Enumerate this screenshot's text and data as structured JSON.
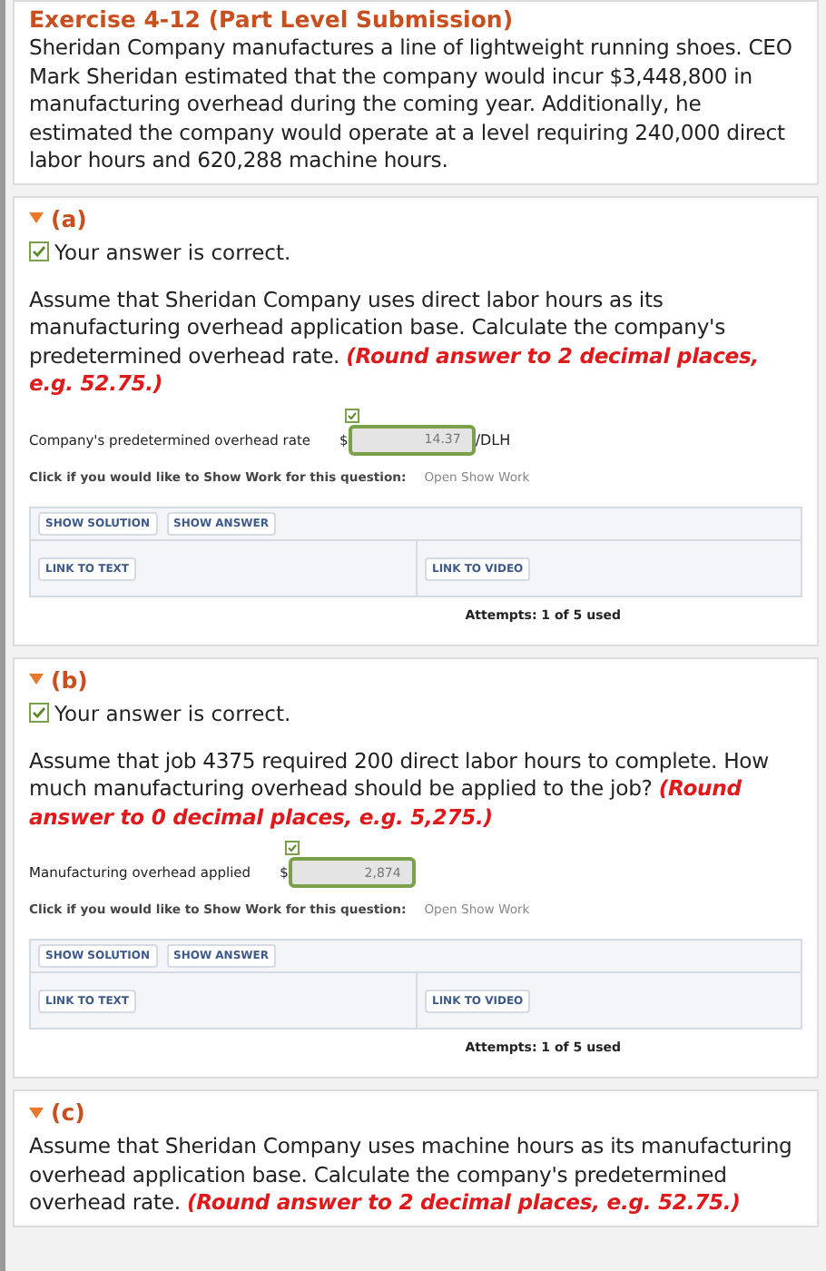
{
  "exercise": {
    "title": "Exercise 4-12 (Part Level Submission)",
    "text": "Sheridan Company manufactures a line of lightweight running shoes. CEO Mark Sheridan estimated that the company would incur $3,448,800 in manufacturing overhead during the coming year. Additionally, he estimated the company would operate at a level requiring 240,000 direct labor hours and 620,288 machine hours."
  },
  "parts": [
    {
      "label": "(a)",
      "expanded": true,
      "feedback": {
        "correct": true,
        "text": "Your answer is correct."
      },
      "question": "Assume that Sheridan Company uses direct labor hours as its manufacturing overhead application base. Calculate the company's predetermined overhead rate.",
      "instruction": "(Round answer to 2 decimal places, e.g. 52.75.)",
      "answer": {
        "label": "Company's predetermined overhead rate",
        "currency": "$",
        "value": "14.37",
        "unit": "/DLH",
        "correct": true
      },
      "show_work": {
        "prompt": "Click if you would like to Show Work for this question:",
        "link": "Open Show Work"
      },
      "buttons": [
        "SHOW SOLUTION",
        "SHOW ANSWER"
      ],
      "links": [
        "LINK TO TEXT",
        "LINK TO VIDEO"
      ],
      "attempts": "Attempts: 1 of 5 used"
    },
    {
      "label": "(b)",
      "expanded": true,
      "feedback": {
        "correct": true,
        "text": "Your answer is correct."
      },
      "question": "Assume that job 4375 required 200 direct labor hours to complete. How much manufacturing overhead should be applied to the job?",
      "instruction": "(Round answer to 0 decimal places, e.g. 5,275.)",
      "answer": {
        "label": "Manufacturing overhead applied",
        "currency": "$",
        "value": "2,874",
        "correct": true
      },
      "show_work": {
        "prompt": "Click if you would like to Show Work for this question:",
        "link": "Open Show Work"
      },
      "buttons": [
        "SHOW SOLUTION",
        "SHOW ANSWER"
      ],
      "links": [
        "LINK TO TEXT",
        "LINK TO VIDEO"
      ],
      "attempts": "Attempts: 1 of 5 used"
    },
    {
      "label": "(c)",
      "expanded": true,
      "question": "Assume that Sheridan Company uses machine hours as its manufacturing overhead application base. Calculate the company's predetermined overhead rate.",
      "instruction": "(Round answer to 2 decimal places, e.g. 52.75.)"
    }
  ]
}
